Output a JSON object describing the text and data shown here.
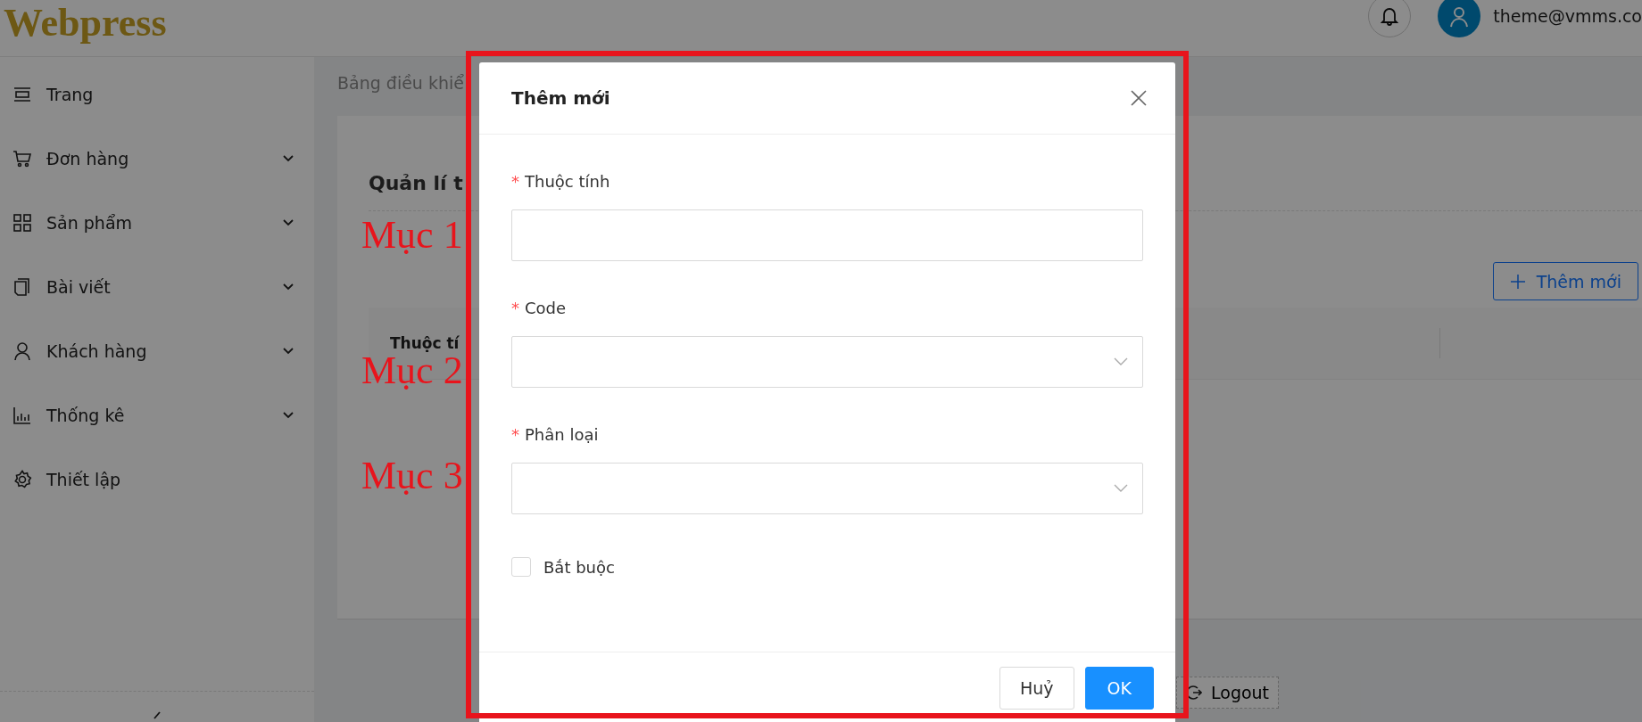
{
  "header": {
    "logo": "Webpress",
    "user_email": "theme@vmms.co"
  },
  "sidebar": {
    "items": [
      {
        "label": "Trang",
        "expandable": false
      },
      {
        "label": "Đơn hàng",
        "expandable": true
      },
      {
        "label": "Sản phẩm",
        "expandable": true
      },
      {
        "label": "Bài viết",
        "expandable": true
      },
      {
        "label": "Khách hàng",
        "expandable": true
      },
      {
        "label": "Thống kê",
        "expandable": true
      },
      {
        "label": "Thiết lập",
        "expandable": false
      }
    ]
  },
  "main": {
    "breadcrumb": "Bảng điều khiể",
    "card": {
      "title": "Quản lí t",
      "add_button": "Thêm mới",
      "table": {
        "columns": [
          "Thuộc tí"
        ]
      }
    },
    "logout": "Logout"
  },
  "annotations": [
    "Mục 1",
    "Mục 2",
    "Mục 3"
  ],
  "modal": {
    "title": "Thêm mới",
    "fields": [
      {
        "label": "Thuộc tính",
        "kind": "text",
        "required_mark": "*"
      },
      {
        "label": "Code",
        "kind": "select",
        "required_mark": "*"
      },
      {
        "label": "Phân loại",
        "kind": "select",
        "required_mark": "*"
      }
    ],
    "checkbox": {
      "label": "Bắt buộc",
      "checked": false
    },
    "buttons": [
      {
        "label": "Huỷ",
        "primary": false
      },
      {
        "label": "OK",
        "primary": true
      }
    ]
  }
}
